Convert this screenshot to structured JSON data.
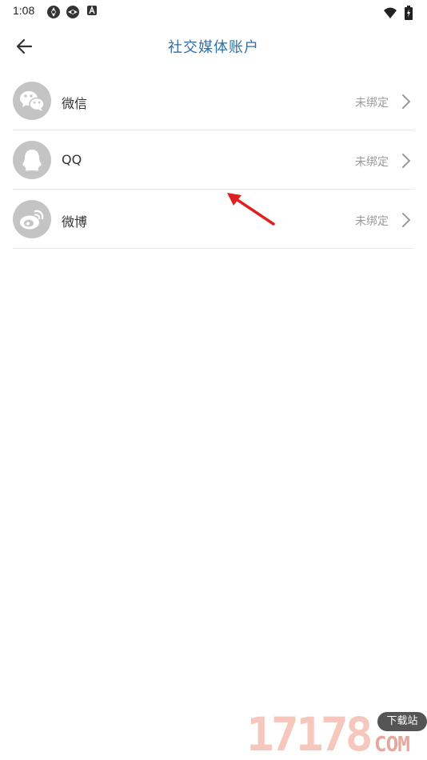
{
  "status_bar": {
    "time": "1:08",
    "battery_label": "battery-charging-icon"
  },
  "header": {
    "title": "社交媒体账户",
    "back_icon": "arrow-left-icon"
  },
  "accounts": [
    {
      "name": "微信",
      "status": "未绑定",
      "icon": "wechat-icon"
    },
    {
      "name": "QQ",
      "status": "未绑定",
      "icon": "qq-penguin-icon"
    },
    {
      "name": "微博",
      "status": "未绑定",
      "icon": "weibo-icon"
    }
  ],
  "watermark": {
    "number": "17178",
    "badge": "下载站",
    "domain": "COM"
  },
  "colors": {
    "title": "#2f6fa6",
    "avatar_bg": "#c4c4c4",
    "status_text": "#9a9a9a",
    "divider": "#e8e8e8",
    "annotation": "#e02020"
  }
}
